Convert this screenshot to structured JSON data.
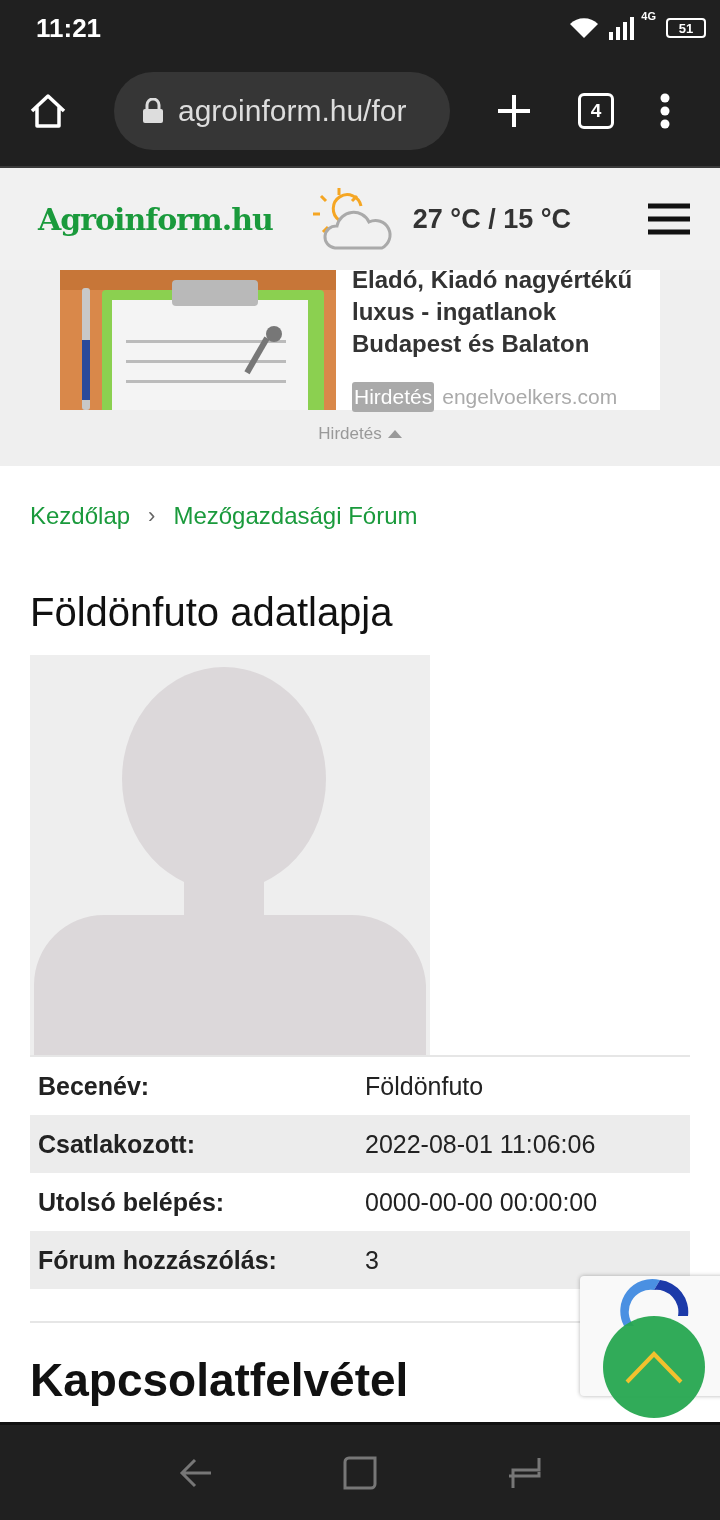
{
  "status_bar": {
    "time": "11:21",
    "network": "4G",
    "battery": "51"
  },
  "browser": {
    "url": "agroinform.hu/for",
    "tab_count": "4"
  },
  "site_header": {
    "logo": "Agroinform.hu",
    "weather": "27 °C / 15 °C"
  },
  "ad": {
    "headline": "Eladó, Kiadó nagyértékű luxus - ingatlanok Budapest és Balaton",
    "badge": "Hirdetés",
    "source": "engelvoelkers.com",
    "toggle": "Hirdetés"
  },
  "breadcrumb": [
    {
      "label": "Kezdőlap"
    },
    {
      "label": "Mezőgazdasági Fórum"
    }
  ],
  "breadcrumb_separator": "›",
  "page_title": "Földönfuto adatlapja",
  "profile": {
    "rows": [
      {
        "label": "Becenév:",
        "value": "Földönfuto"
      },
      {
        "label": "Csatlakozott:",
        "value": "2022-08-01 11:06:06"
      },
      {
        "label": "Utolsó belépés:",
        "value": "0000-00-00 00:00:00"
      },
      {
        "label": "Fórum hozzászólás:",
        "value": "3"
      }
    ]
  },
  "section_title": "Kapcsolatfelvétel"
}
